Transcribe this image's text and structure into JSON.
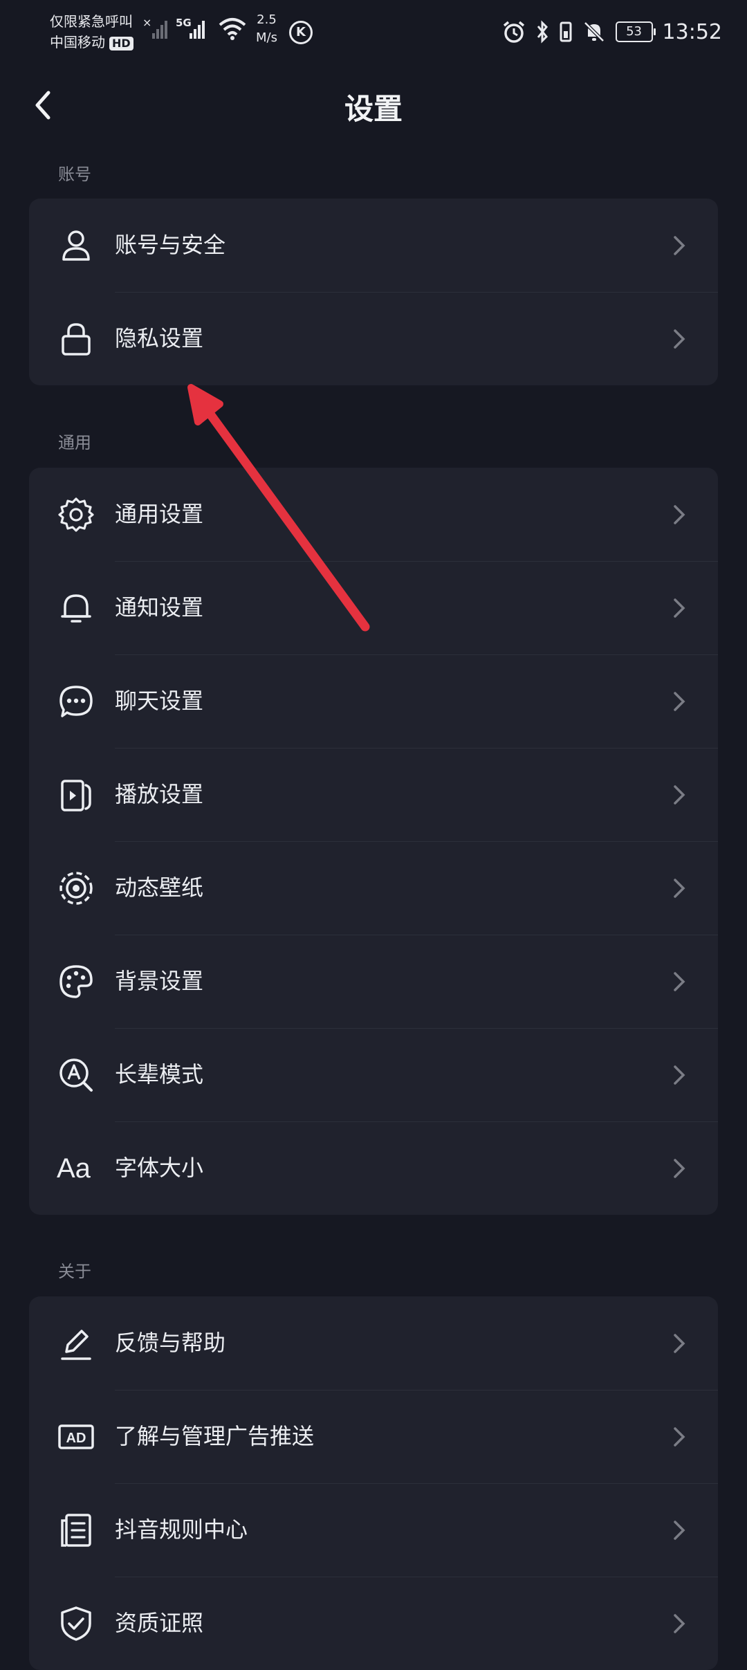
{
  "status": {
    "carrier_line1": "仅限紧急呼叫",
    "carrier_line2": "中国移动",
    "hd": "HD",
    "sig_5g": "5G",
    "net_speed": "2.5",
    "net_unit": "M/s",
    "k_badge": "K",
    "battery": "53",
    "time": "13:52"
  },
  "header": {
    "title": "设置"
  },
  "sections": {
    "account": {
      "label": "账号",
      "items": [
        {
          "label": "账号与安全",
          "icon": "user-icon"
        },
        {
          "label": "隐私设置",
          "icon": "lock-icon"
        }
      ]
    },
    "general": {
      "label": "通用",
      "items": [
        {
          "label": "通用设置",
          "icon": "gear-icon"
        },
        {
          "label": "通知设置",
          "icon": "bell-icon"
        },
        {
          "label": "聊天设置",
          "icon": "chat-icon"
        },
        {
          "label": "播放设置",
          "icon": "play-icon"
        },
        {
          "label": "动态壁纸",
          "icon": "target-icon"
        },
        {
          "label": "背景设置",
          "icon": "palette-icon"
        },
        {
          "label": "长辈模式",
          "icon": "magnifier-a-icon"
        },
        {
          "label": "字体大小",
          "icon": "font-size-icon",
          "glyph": "Aa"
        }
      ]
    },
    "about": {
      "label": "关于",
      "items": [
        {
          "label": "反馈与帮助",
          "icon": "edit-icon"
        },
        {
          "label": "了解与管理广告推送",
          "icon": "ad-icon",
          "glyph": "AD"
        },
        {
          "label": "抖音规则中心",
          "icon": "document-icon"
        },
        {
          "label": "资质证照",
          "icon": "shield-check-icon"
        }
      ]
    }
  },
  "colors": {
    "background": "#161822",
    "card": "#20222d",
    "annotation": "#e5323f"
  }
}
